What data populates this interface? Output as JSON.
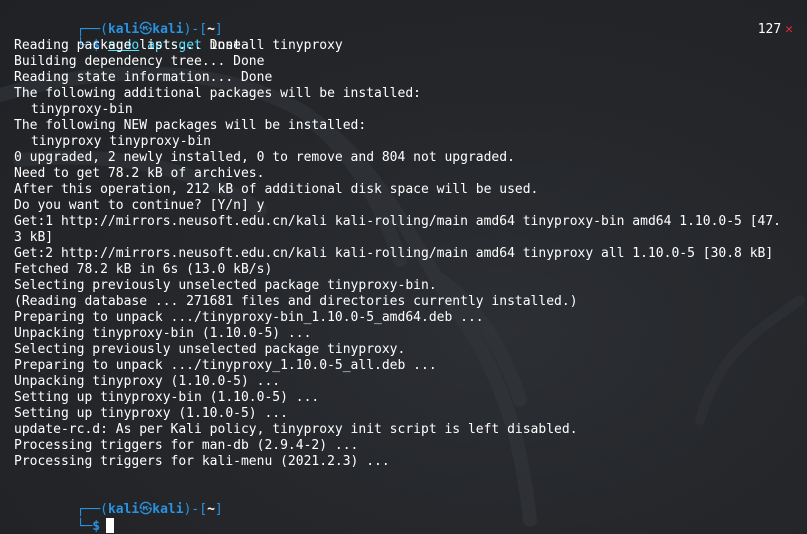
{
  "prompt": {
    "frame_top": "┌──(",
    "frame_mid_close": ")-[",
    "frame_end": "]",
    "frame_bottom": "└─",
    "user": "kali",
    "at_symbol": "㉿",
    "host": "kali",
    "path": "~",
    "dollar": "$"
  },
  "first_command": {
    "sudo": "sudo",
    "apt": "apt-get",
    "rest": " install tinyproxy",
    "status_code": "127",
    "status_mark": "✕"
  },
  "output_lines": [
    {
      "text": "Reading package lists... Done",
      "indent": false
    },
    {
      "text": "Building dependency tree... Done",
      "indent": false
    },
    {
      "text": "Reading state information... Done",
      "indent": false
    },
    {
      "text": "The following additional packages will be installed:",
      "indent": false
    },
    {
      "text": "tinyproxy-bin",
      "indent": true
    },
    {
      "text": "The following NEW packages will be installed:",
      "indent": false
    },
    {
      "text": "tinyproxy tinyproxy-bin",
      "indent": true
    },
    {
      "text": "0 upgraded, 2 newly installed, 0 to remove and 804 not upgraded.",
      "indent": false
    },
    {
      "text": "Need to get 78.2 kB of archives.",
      "indent": false
    },
    {
      "text": "After this operation, 212 kB of additional disk space will be used.",
      "indent": false
    },
    {
      "text": "Do you want to continue? [Y/n] y",
      "indent": false
    },
    {
      "text": "Get:1 http://mirrors.neusoft.edu.cn/kali kali-rolling/main amd64 tinyproxy-bin amd64 1.10.0-5 [47.",
      "indent": false
    },
    {
      "text": "3 kB]",
      "indent": false
    },
    {
      "text": "Get:2 http://mirrors.neusoft.edu.cn/kali kali-rolling/main amd64 tinyproxy all 1.10.0-5 [30.8 kB]",
      "indent": false
    },
    {
      "text": "Fetched 78.2 kB in 6s (13.0 kB/s)",
      "indent": false
    },
    {
      "text": "Selecting previously unselected package tinyproxy-bin.",
      "indent": false
    },
    {
      "text": "(Reading database ... 271681 files and directories currently installed.)",
      "indent": false
    },
    {
      "text": "Preparing to unpack .../tinyproxy-bin_1.10.0-5_amd64.deb ...",
      "indent": false
    },
    {
      "text": "Unpacking tinyproxy-bin (1.10.0-5) ...",
      "indent": false
    },
    {
      "text": "Selecting previously unselected package tinyproxy.",
      "indent": false
    },
    {
      "text": "Preparing to unpack .../tinyproxy_1.10.0-5_all.deb ...",
      "indent": false
    },
    {
      "text": "Unpacking tinyproxy (1.10.0-5) ...",
      "indent": false
    },
    {
      "text": "Setting up tinyproxy-bin (1.10.0-5) ...",
      "indent": false
    },
    {
      "text": "Setting up tinyproxy (1.10.0-5) ...",
      "indent": false
    },
    {
      "text": "update-rc.d: As per Kali policy, tinyproxy init script is left disabled.",
      "indent": false
    },
    {
      "text": "Processing triggers for man-db (2.9.4-2) ...",
      "indent": false
    },
    {
      "text": "Processing triggers for kali-menu (2021.2.3) ...",
      "indent": false
    }
  ],
  "colors": {
    "background": "#222427",
    "prompt_blue": "#2a93e0",
    "command_cyan": "#54e1ff",
    "error_red": "#e0303a",
    "text": "#ffffff"
  }
}
